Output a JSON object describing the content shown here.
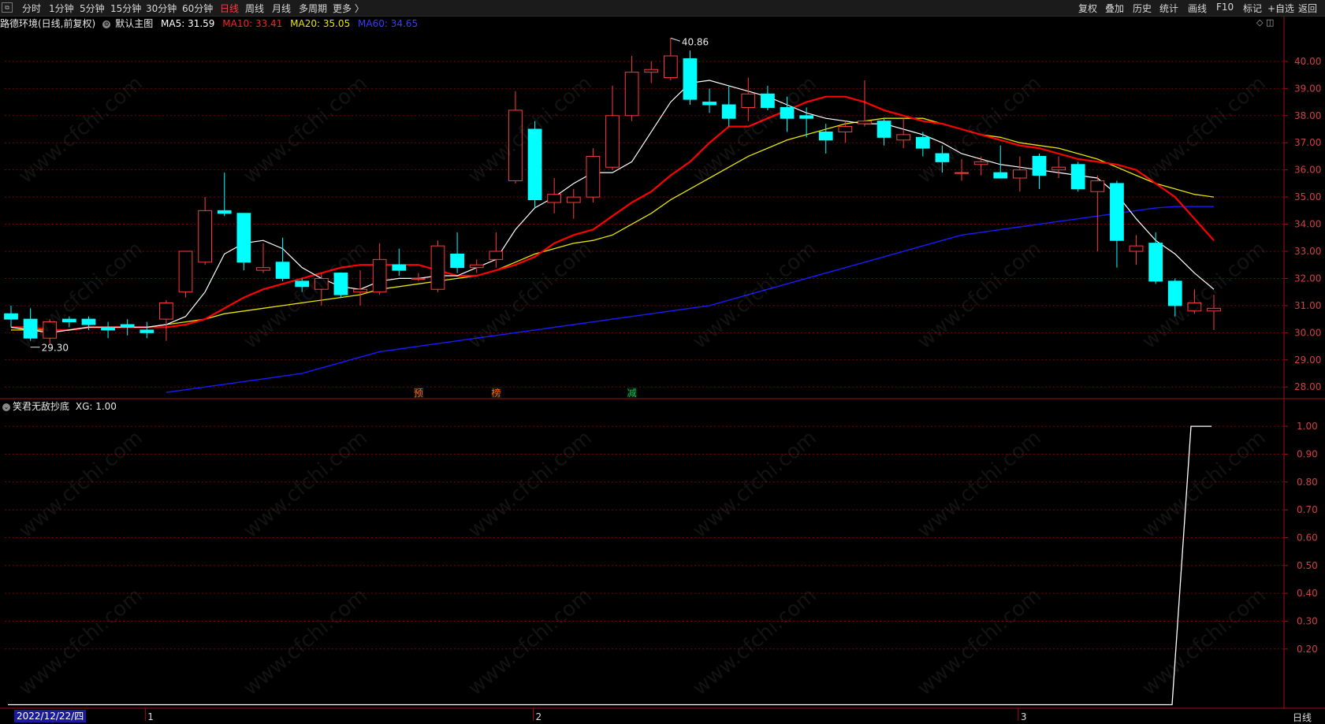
{
  "toolbar": {
    "left_icon": "⧉",
    "left": [
      {
        "label": "分时",
        "active": false
      },
      {
        "label": "1分钟",
        "active": false
      },
      {
        "label": "5分钟",
        "active": false
      },
      {
        "label": "15分钟",
        "active": false
      },
      {
        "label": "30分钟",
        "active": false
      },
      {
        "label": "60分钟",
        "active": false
      },
      {
        "label": "日线",
        "active": true
      },
      {
        "label": "周线",
        "active": false
      },
      {
        "label": "月线",
        "active": false
      },
      {
        "label": "多周期",
        "active": false
      },
      {
        "label": "更多 〉",
        "active": false
      }
    ],
    "right": [
      "复权",
      "叠加",
      "历史",
      "统计",
      "画线",
      "F10",
      "标记",
      "+自选",
      "返回"
    ]
  },
  "main_panel": {
    "stock_title": "路德环境(日线,前复权)",
    "indicator_name": "默认主图",
    "ma5": "MA5: 31.59",
    "ma10": "MA10: 33.41",
    "ma20": "MA20: 35.05",
    "ma60": "MA60: 34.65",
    "top_icons": "◇ ◫",
    "high_label": "40.86",
    "low_label": "29.30"
  },
  "sub_panel": {
    "indicator_name": "笑君无敌抄底",
    "xg": "XG: 1.00"
  },
  "bottom": {
    "date_label": "2022/12/22/四",
    "period_label": "日线",
    "month_markers": [
      "1",
      "2",
      "3"
    ]
  },
  "watermark": "www.cfchi.com",
  "colors": {
    "up_candle": "#ff3b3b",
    "down_candle": "#00ffff",
    "ma5": "#ffffff",
    "ma10": "#ff0000",
    "ma20": "#e6e600",
    "ma60": "#1a1aff",
    "grid": "#7a0000",
    "axis": "#a01010",
    "signal_line": "#ffffff"
  },
  "chart_data": [
    {
      "type": "candlestick",
      "title": "路德环境(日线,前复权)",
      "y_axis_ticks": [
        40.0,
        39.0,
        38.0,
        37.0,
        36.0,
        35.0,
        34.0,
        33.0,
        32.0,
        31.0,
        30.0,
        29.0,
        28.0
      ],
      "ylim": [
        27.6,
        41.1
      ],
      "candles": [
        {
          "o": 30.7,
          "h": 31.0,
          "l": 30.2,
          "c": 30.5
        },
        {
          "o": 30.5,
          "h": 30.9,
          "l": 29.7,
          "c": 29.8
        },
        {
          "o": 29.8,
          "h": 30.5,
          "l": 29.6,
          "c": 30.4
        },
        {
          "o": 30.5,
          "h": 30.6,
          "l": 30.2,
          "c": 30.4
        },
        {
          "o": 30.5,
          "h": 30.6,
          "l": 30.1,
          "c": 30.3
        },
        {
          "o": 30.2,
          "h": 30.4,
          "l": 29.8,
          "c": 30.1
        },
        {
          "o": 30.3,
          "h": 30.5,
          "l": 29.9,
          "c": 30.2
        },
        {
          "o": 30.1,
          "h": 30.4,
          "l": 29.8,
          "c": 30.0
        },
        {
          "o": 30.5,
          "h": 31.2,
          "l": 29.7,
          "c": 31.1
        },
        {
          "o": 31.5,
          "h": 33.0,
          "l": 31.3,
          "c": 33.0
        },
        {
          "o": 32.6,
          "h": 35.0,
          "l": 32.5,
          "c": 34.5
        },
        {
          "o": 34.5,
          "h": 35.9,
          "l": 34.3,
          "c": 34.4
        },
        {
          "o": 34.4,
          "h": 34.4,
          "l": 32.3,
          "c": 32.6
        },
        {
          "o": 32.3,
          "h": 33.3,
          "l": 32.2,
          "c": 32.4
        },
        {
          "o": 32.6,
          "h": 33.5,
          "l": 31.9,
          "c": 32.0
        },
        {
          "o": 31.9,
          "h": 32.0,
          "l": 31.5,
          "c": 31.7
        },
        {
          "o": 31.6,
          "h": 32.2,
          "l": 31.0,
          "c": 32.0
        },
        {
          "o": 32.2,
          "h": 32.2,
          "l": 31.3,
          "c": 31.4
        },
        {
          "o": 31.5,
          "h": 32.3,
          "l": 31.0,
          "c": 31.6
        },
        {
          "o": 31.5,
          "h": 33.3,
          "l": 31.4,
          "c": 32.7
        },
        {
          "o": 32.5,
          "h": 33.1,
          "l": 32.1,
          "c": 32.3
        },
        {
          "o": 32.0,
          "h": 32.2,
          "l": 31.9,
          "c": 32.0
        },
        {
          "o": 31.6,
          "h": 33.4,
          "l": 31.5,
          "c": 33.2
        },
        {
          "o": 32.9,
          "h": 33.7,
          "l": 32.2,
          "c": 32.4
        },
        {
          "o": 32.4,
          "h": 32.7,
          "l": 32.2,
          "c": 32.5
        },
        {
          "o": 32.7,
          "h": 33.7,
          "l": 32.4,
          "c": 33.0
        },
        {
          "o": 35.6,
          "h": 38.9,
          "l": 35.5,
          "c": 38.2
        },
        {
          "o": 37.5,
          "h": 37.8,
          "l": 34.6,
          "c": 34.9
        },
        {
          "o": 34.8,
          "h": 35.7,
          "l": 34.4,
          "c": 35.1
        },
        {
          "o": 34.8,
          "h": 35.3,
          "l": 34.2,
          "c": 35.0
        },
        {
          "o": 35.0,
          "h": 36.8,
          "l": 34.8,
          "c": 36.5
        },
        {
          "o": 36.1,
          "h": 39.1,
          "l": 36.0,
          "c": 38.0
        },
        {
          "o": 38.0,
          "h": 40.2,
          "l": 37.8,
          "c": 39.6
        },
        {
          "o": 39.6,
          "h": 40.0,
          "l": 39.2,
          "c": 39.7
        },
        {
          "o": 39.4,
          "h": 40.86,
          "l": 39.3,
          "c": 40.2
        },
        {
          "o": 40.1,
          "h": 40.4,
          "l": 38.4,
          "c": 38.6
        },
        {
          "o": 38.5,
          "h": 39.0,
          "l": 38.1,
          "c": 38.4
        },
        {
          "o": 38.4,
          "h": 39.1,
          "l": 37.6,
          "c": 37.9
        },
        {
          "o": 38.3,
          "h": 39.4,
          "l": 37.8,
          "c": 38.8
        },
        {
          "o": 38.8,
          "h": 39.1,
          "l": 38.2,
          "c": 38.3
        },
        {
          "o": 38.3,
          "h": 38.7,
          "l": 37.4,
          "c": 37.9
        },
        {
          "o": 38.0,
          "h": 38.3,
          "l": 37.2,
          "c": 37.9
        },
        {
          "o": 37.4,
          "h": 37.7,
          "l": 36.6,
          "c": 37.1
        },
        {
          "o": 37.4,
          "h": 37.8,
          "l": 37.0,
          "c": 37.6
        },
        {
          "o": 37.7,
          "h": 39.3,
          "l": 37.6,
          "c": 37.8
        },
        {
          "o": 37.8,
          "h": 37.9,
          "l": 36.9,
          "c": 37.2
        },
        {
          "o": 37.1,
          "h": 37.9,
          "l": 36.8,
          "c": 37.3
        },
        {
          "o": 37.2,
          "h": 37.4,
          "l": 36.5,
          "c": 36.8
        },
        {
          "o": 36.6,
          "h": 36.9,
          "l": 35.9,
          "c": 36.3
        },
        {
          "o": 35.9,
          "h": 36.4,
          "l": 35.6,
          "c": 35.9
        },
        {
          "o": 36.2,
          "h": 36.5,
          "l": 35.8,
          "c": 36.3
        },
        {
          "o": 35.9,
          "h": 36.9,
          "l": 35.7,
          "c": 35.7
        },
        {
          "o": 35.7,
          "h": 36.5,
          "l": 35.2,
          "c": 36.0
        },
        {
          "o": 36.5,
          "h": 36.6,
          "l": 35.3,
          "c": 35.8
        },
        {
          "o": 36.0,
          "h": 36.5,
          "l": 35.7,
          "c": 36.1
        },
        {
          "o": 36.2,
          "h": 36.3,
          "l": 35.2,
          "c": 35.3
        },
        {
          "o": 35.2,
          "h": 35.8,
          "l": 33.0,
          "c": 35.6
        },
        {
          "o": 35.5,
          "h": 35.6,
          "l": 32.4,
          "c": 33.4
        },
        {
          "o": 33.0,
          "h": 33.6,
          "l": 32.5,
          "c": 33.2
        },
        {
          "o": 33.3,
          "h": 33.7,
          "l": 31.8,
          "c": 31.9
        },
        {
          "o": 31.9,
          "h": 32.0,
          "l": 30.6,
          "c": 31.0
        },
        {
          "o": 30.8,
          "h": 31.6,
          "l": 30.7,
          "c": 31.1
        },
        {
          "o": 30.8,
          "h": 31.4,
          "l": 30.1,
          "c": 30.9
        }
      ],
      "series": [
        {
          "name": "MA5",
          "values": [
            30.2,
            30.1,
            30.0,
            30.1,
            30.2,
            30.2,
            30.2,
            30.2,
            30.3,
            30.6,
            31.5,
            32.9,
            33.3,
            33.4,
            33.1,
            32.4,
            32.0,
            31.7,
            31.6,
            31.9,
            32.0,
            32.0,
            32.1,
            32.1,
            32.4,
            32.7,
            33.8,
            34.6,
            35.0,
            35.5,
            35.9,
            35.9,
            36.3,
            37.4,
            38.5,
            39.2,
            39.3,
            39.1,
            38.9,
            38.7,
            38.4,
            38.1,
            37.9,
            37.8,
            37.7,
            37.7,
            37.5,
            37.3,
            37.0,
            36.6,
            36.4,
            36.2,
            36.1,
            36.0,
            35.9,
            35.8,
            35.7,
            35.1,
            34.2,
            33.4,
            32.9,
            32.2,
            31.6
          ]
        },
        {
          "name": "MA10",
          "values": [
            30.2,
            30.2,
            30.1,
            30.1,
            30.2,
            30.2,
            30.2,
            30.2,
            30.2,
            30.3,
            30.5,
            30.9,
            31.3,
            31.6,
            31.8,
            32.0,
            32.2,
            32.4,
            32.5,
            32.5,
            32.5,
            32.5,
            32.3,
            32.1,
            32.1,
            32.3,
            32.5,
            32.8,
            33.3,
            33.6,
            33.8,
            34.3,
            34.8,
            35.2,
            35.8,
            36.3,
            37.0,
            37.6,
            37.6,
            37.9,
            38.2,
            38.5,
            38.7,
            38.7,
            38.5,
            38.2,
            38.0,
            37.8,
            37.7,
            37.5,
            37.3,
            37.1,
            36.9,
            36.8,
            36.6,
            36.4,
            36.3,
            36.2,
            36.0,
            35.5,
            35.0,
            34.2,
            33.4
          ]
        },
        {
          "name": "MA20",
          "values": [
            30.1,
            30.1,
            30.1,
            30.1,
            30.2,
            30.2,
            30.2,
            30.2,
            30.3,
            30.4,
            30.5,
            30.7,
            30.8,
            30.9,
            31.0,
            31.1,
            31.2,
            31.3,
            31.4,
            31.6,
            31.7,
            31.8,
            31.9,
            32.0,
            32.1,
            32.3,
            32.6,
            32.9,
            33.1,
            33.3,
            33.4,
            33.6,
            34.0,
            34.4,
            34.9,
            35.3,
            35.7,
            36.1,
            36.5,
            36.8,
            37.1,
            37.3,
            37.5,
            37.7,
            37.8,
            37.9,
            37.9,
            37.9,
            37.7,
            37.5,
            37.3,
            37.2,
            37.0,
            36.9,
            36.8,
            36.6,
            36.4,
            36.1,
            35.8,
            35.5,
            35.3,
            35.1,
            35.0
          ]
        },
        {
          "name": "MA60",
          "values": [
            27.8,
            27.9,
            28.0,
            28.1,
            28.2,
            28.3,
            28.4,
            28.5,
            28.7,
            28.9,
            29.1,
            29.3,
            29.4,
            29.5,
            29.6,
            29.7,
            29.8,
            29.9,
            30.0,
            30.1,
            30.2,
            30.3,
            30.4,
            30.5,
            30.6,
            30.7,
            30.8,
            30.9,
            31.0,
            31.2,
            31.4,
            31.6,
            31.8,
            32.0,
            32.2,
            32.4,
            32.6,
            32.8,
            33.0,
            33.2,
            33.4,
            33.6,
            33.7,
            33.8,
            33.9,
            34.0,
            34.1,
            34.2,
            34.3,
            34.4,
            34.5,
            34.6,
            34.65,
            34.65,
            34.65
          ]
        }
      ],
      "markers": [
        {
          "index": 21,
          "text": "预",
          "color": "#ff6a00"
        },
        {
          "index": 25,
          "text": "榜",
          "color": "#ff6a00"
        },
        {
          "index": 32,
          "text": "减",
          "color": "#00cc44"
        }
      ]
    },
    {
      "type": "line",
      "title": "笑君无敌抄底",
      "y_axis_ticks": [
        1.0,
        0.9,
        0.8,
        0.7,
        0.6,
        0.5,
        0.4,
        0.3,
        0.2
      ],
      "ylim": [
        -0.01,
        1.04
      ],
      "series": [
        {
          "name": "XG",
          "x": [
            0,
            59,
            60,
            61
          ],
          "values": [
            0,
            0,
            1,
            1
          ]
        }
      ]
    }
  ]
}
